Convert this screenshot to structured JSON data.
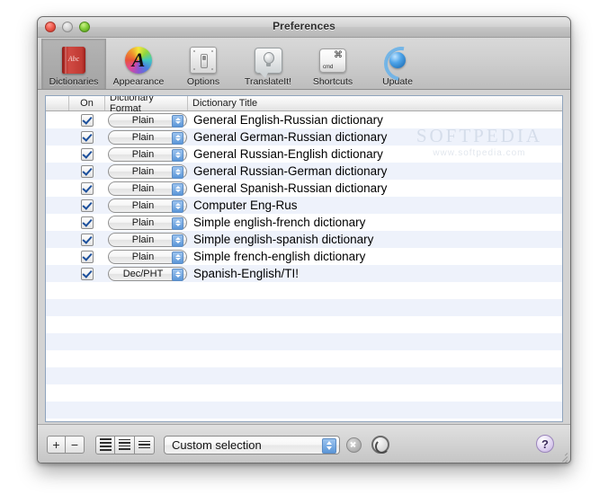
{
  "window": {
    "title": "Preferences",
    "traffic_lights": [
      "close-button",
      "minimize-button",
      "zoom-button"
    ]
  },
  "toolbar": {
    "items": [
      {
        "label": "Dictionaries",
        "icon": "book-icon",
        "selected": true
      },
      {
        "label": "Appearance",
        "icon": "color-wheel-icon",
        "selected": false
      },
      {
        "label": "Options",
        "icon": "switch-panel-icon",
        "selected": false
      },
      {
        "label": "TranslateIt!",
        "icon": "speech-bubble-icon",
        "selected": false
      },
      {
        "label": "Shortcuts",
        "icon": "command-key-icon",
        "selected": false
      },
      {
        "label": "Update",
        "icon": "update-globe-icon",
        "selected": false
      }
    ]
  },
  "table": {
    "columns": [
      "",
      "On",
      "Dictionary Format",
      "Dictionary Title"
    ],
    "rows": [
      {
        "on": true,
        "format": "Plain",
        "title": "General English-Russian dictionary"
      },
      {
        "on": true,
        "format": "Plain",
        "title": "General German-Russian dictionary"
      },
      {
        "on": true,
        "format": "Plain",
        "title": "General Russian-English dictionary"
      },
      {
        "on": true,
        "format": "Plain",
        "title": "General Russian-German dictionary"
      },
      {
        "on": true,
        "format": "Plain",
        "title": "General Spanish-Russian dictionary"
      },
      {
        "on": true,
        "format": "Plain",
        "title": "Computer Eng-Rus"
      },
      {
        "on": true,
        "format": "Plain",
        "title": "Simple english-french dictionary"
      },
      {
        "on": true,
        "format": "Plain",
        "title": "Simple english-spanish dictionary"
      },
      {
        "on": true,
        "format": "Plain",
        "title": "Simple french-english dictionary"
      },
      {
        "on": true,
        "format": "Dec/PHT",
        "title": "Spanish-English/TI!"
      }
    ],
    "empty_row_count": 9
  },
  "watermark": {
    "line1": "SOFTPEDIA",
    "line2": "www.softpedia.com"
  },
  "bottom_bar": {
    "add_label": "+",
    "remove_label": "−",
    "view_modes": [
      "list-view-dense",
      "list-view-medium",
      "list-view-large"
    ],
    "selector_value": "Custom selection",
    "clear_icon": "clear-x-icon",
    "refresh_icon": "refresh-icon",
    "help_label": "?"
  },
  "colors": {
    "row_stripe": "#eef2fb",
    "table_border": "#8fa4bd",
    "accent_blue": "#5b96d8",
    "help_purple": "#c3aee0"
  }
}
